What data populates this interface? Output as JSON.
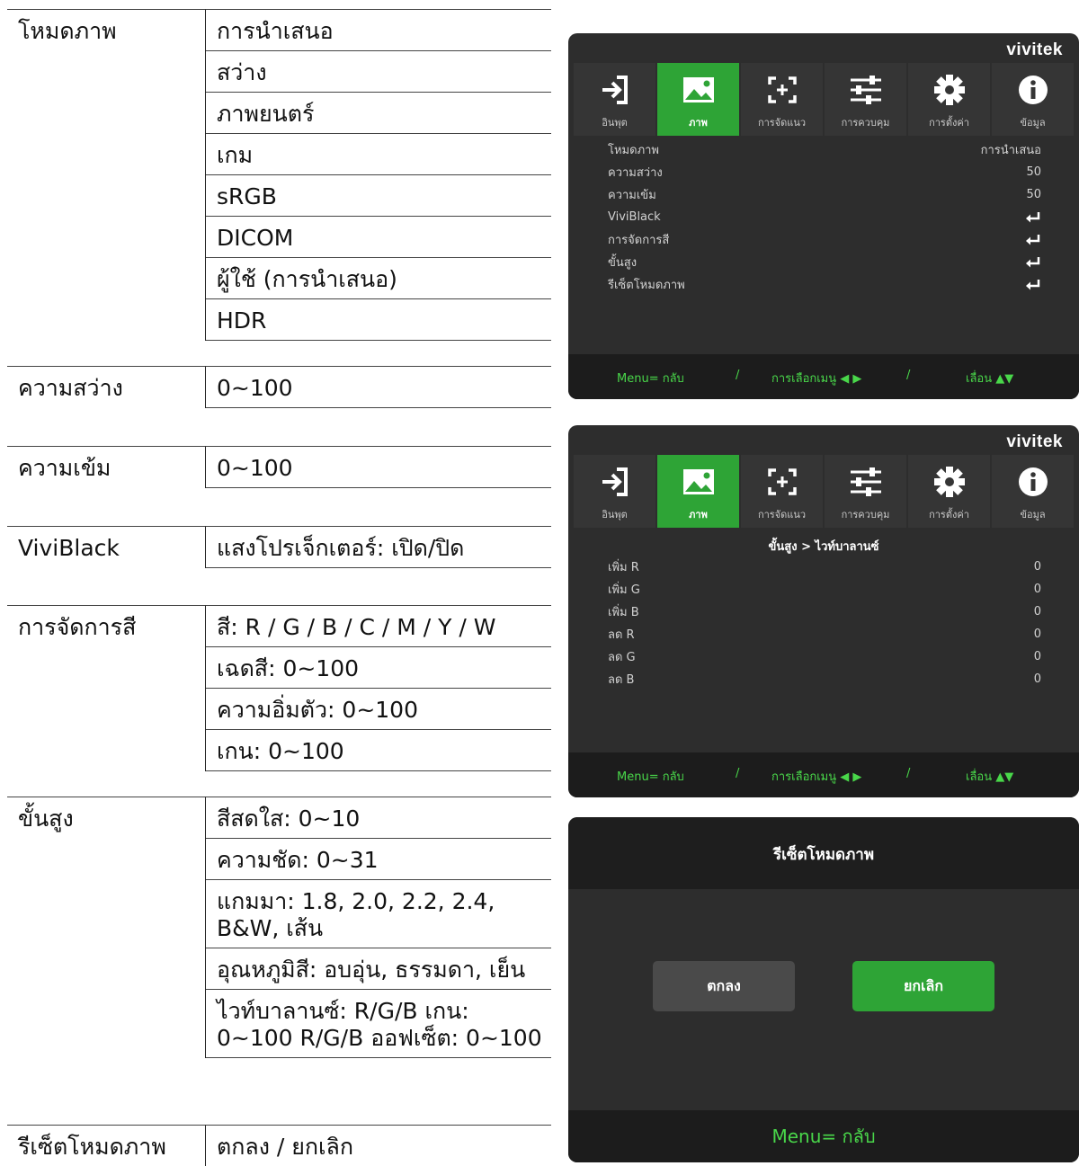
{
  "colors": {
    "osd_bg": "#2d2d2d",
    "accent": "#2ea436",
    "footer_text": "#49d74a"
  },
  "table": [
    {
      "label": "โหมดภาพ",
      "values": [
        "การนำเสนอ",
        "สว่าง",
        "ภาพยนตร์",
        "เกม",
        "sRGB",
        "DICOM",
        "ผู้ใช้ (การนำเสนอ)",
        "HDR"
      ]
    },
    {
      "label": "ความสว่าง",
      "values": [
        "0~100"
      ]
    },
    {
      "label": "ความเข้ม",
      "values": [
        "0~100"
      ]
    },
    {
      "label": "ViviBlack",
      "values": [
        "แสงโปรเจ็กเตอร์: เปิด/ปิด"
      ]
    },
    {
      "label": "การจัดการสี",
      "values": [
        "สี: R / G / B / C / M / Y / W",
        "เฉดสี: 0~100",
        "ความอิ่มตัว: 0~100",
        "เกน: 0~100"
      ]
    },
    {
      "label": "ขั้นสูง",
      "values": [
        "สีสดใส: 0~10",
        "ความชัด: 0~31",
        "แกมมา: 1.8, 2.0, 2.2, 2.4, B&W, เส้น",
        "อุณหภูมิสี: อบอุ่น, ธรรมดา, เย็น",
        "ไวท์บาลานซ์: R/G/B เกน: 0~100 R/G/B ออฟเซ็ต: 0~100"
      ]
    },
    {
      "label": "รีเซ็ตโหมดภาพ",
      "values": [
        "ตกลง / ยกเลิก"
      ]
    }
  ],
  "osd": {
    "logo": "vivitek",
    "tabs": [
      {
        "label": "อินพุต",
        "icon": "input-icon"
      },
      {
        "label": "ภาพ",
        "icon": "image-icon",
        "active": true
      },
      {
        "label": "การจัดแนว",
        "icon": "alignment-icon"
      },
      {
        "label": "การควบคุม",
        "icon": "sliders-icon"
      },
      {
        "label": "การตั้งค่า",
        "icon": "gear-icon"
      },
      {
        "label": "ข้อมูล",
        "icon": "info-icon"
      }
    ],
    "footer": {
      "back": "Menu= กลับ",
      "sep": "/",
      "select": "การเลือกเมนู ◀ ▶",
      "scroll": "เลื่อน ▲▼"
    }
  },
  "menu1": {
    "rows": [
      {
        "label": "โหมดภาพ",
        "value": "การนำเสนอ"
      },
      {
        "label": "ความสว่าง",
        "value": "50"
      },
      {
        "label": "ความเข้ม",
        "value": "50"
      },
      {
        "label": "ViviBlack",
        "value": "",
        "enter": true
      },
      {
        "label": "การจัดการสี",
        "value": "",
        "enter": true
      },
      {
        "label": "ขั้นสูง",
        "value": "",
        "enter": true
      },
      {
        "label": "รีเซ็ตโหมดภาพ",
        "value": "",
        "enter": true
      }
    ]
  },
  "menu2": {
    "subtitle": "ขั้นสูง > ไวท์บาลานซ์",
    "rows": [
      {
        "label": "เพิ่ม R",
        "value": "0"
      },
      {
        "label": "เพิ่ม G",
        "value": "0"
      },
      {
        "label": "เพิ่ม B",
        "value": "0"
      },
      {
        "label": "ลด R",
        "value": "0"
      },
      {
        "label": "ลด G",
        "value": "0"
      },
      {
        "label": "ลด B",
        "value": "0"
      }
    ]
  },
  "dialog": {
    "title": "รีเซ็ตโหมดภาพ",
    "ok": "ตกลง",
    "cancel": "ยกเลิก",
    "footer": "Menu= กลับ"
  }
}
